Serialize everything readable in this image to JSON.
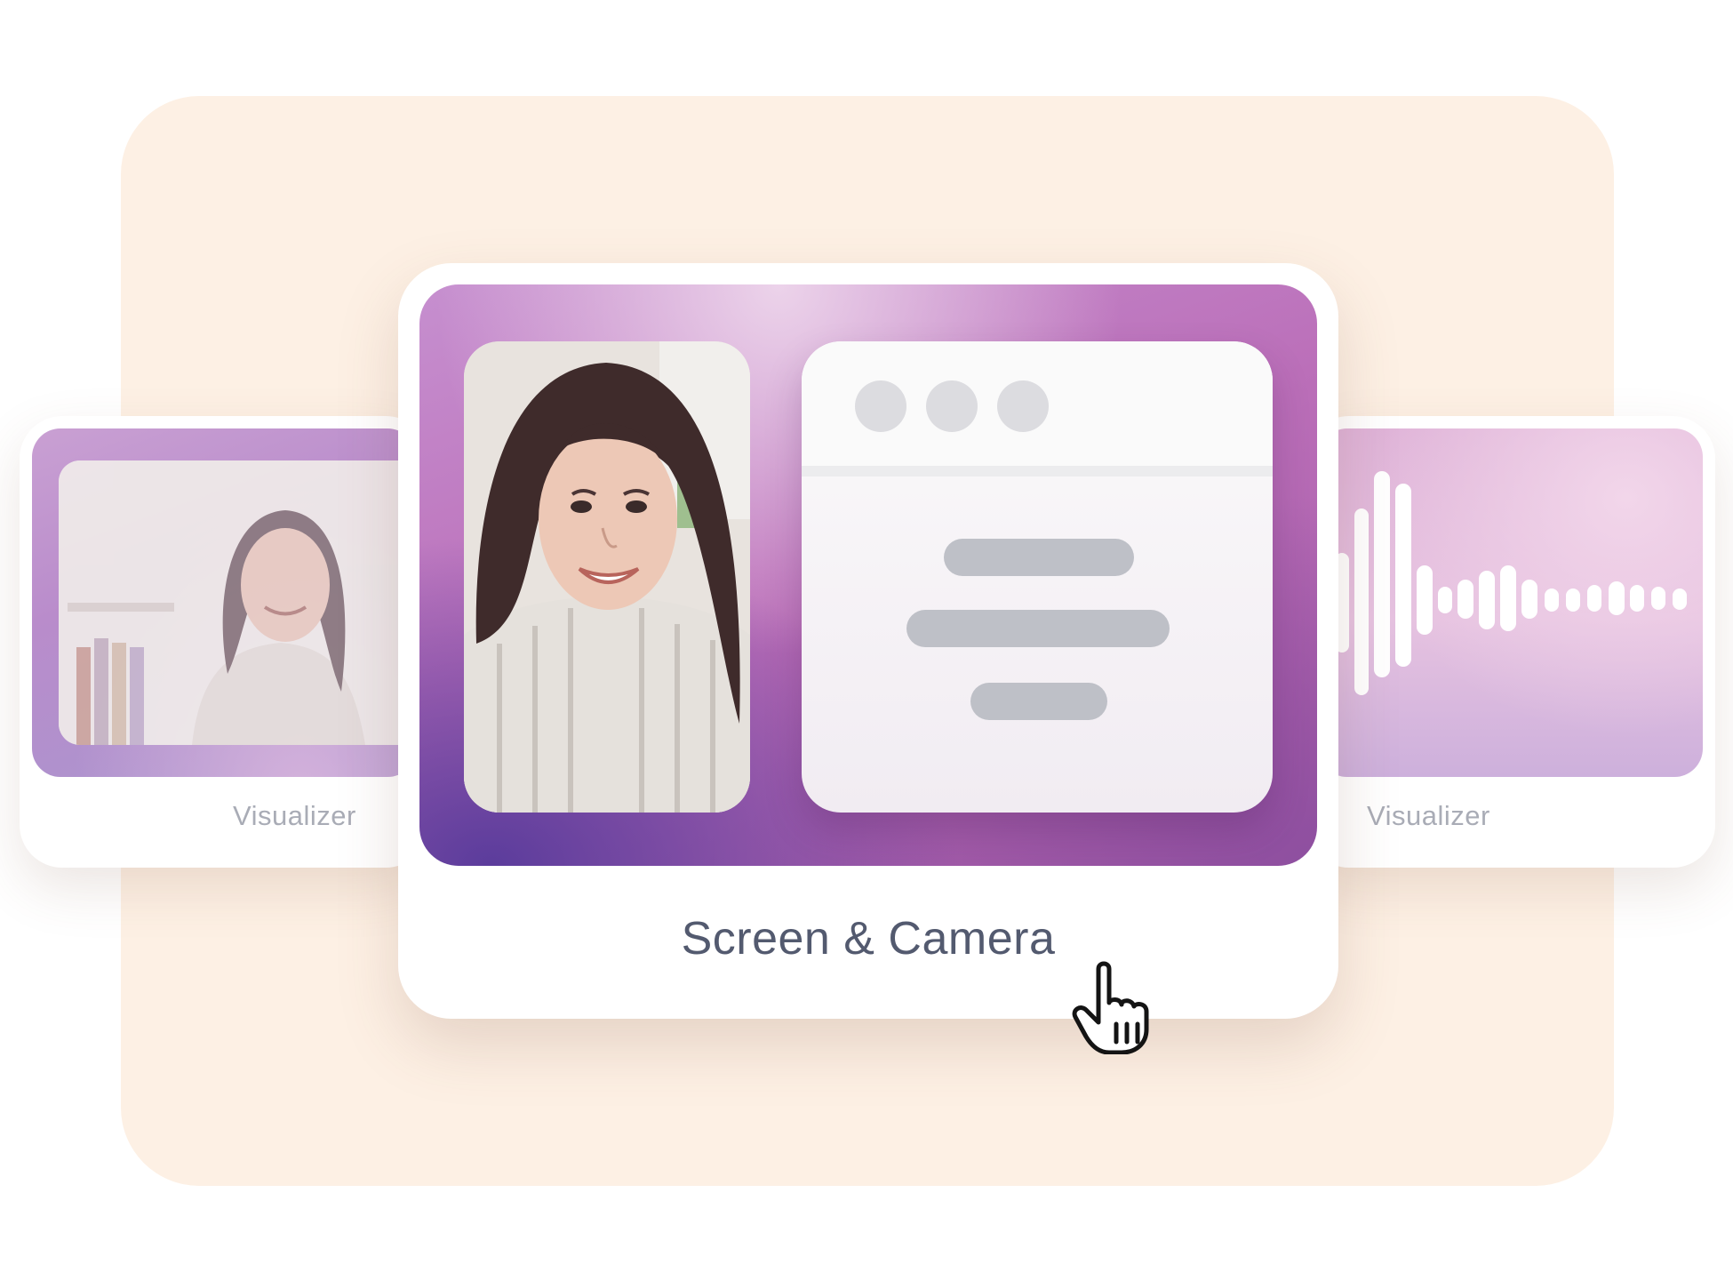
{
  "cards": {
    "left": {
      "label": "Visualizer"
    },
    "center": {
      "label": "Screen & Camera"
    },
    "right": {
      "label": "Visualizer"
    }
  },
  "colors": {
    "backdrop": "#fdf0e4",
    "label_muted": "#a9acb6",
    "label_main": "#535a6f",
    "placeholder_bar": "#bec0c7",
    "window_dot": "#dcdce0"
  },
  "icons": {
    "cursor": "hand-pointer-icon",
    "waveform": "audio-waveform-icon"
  }
}
